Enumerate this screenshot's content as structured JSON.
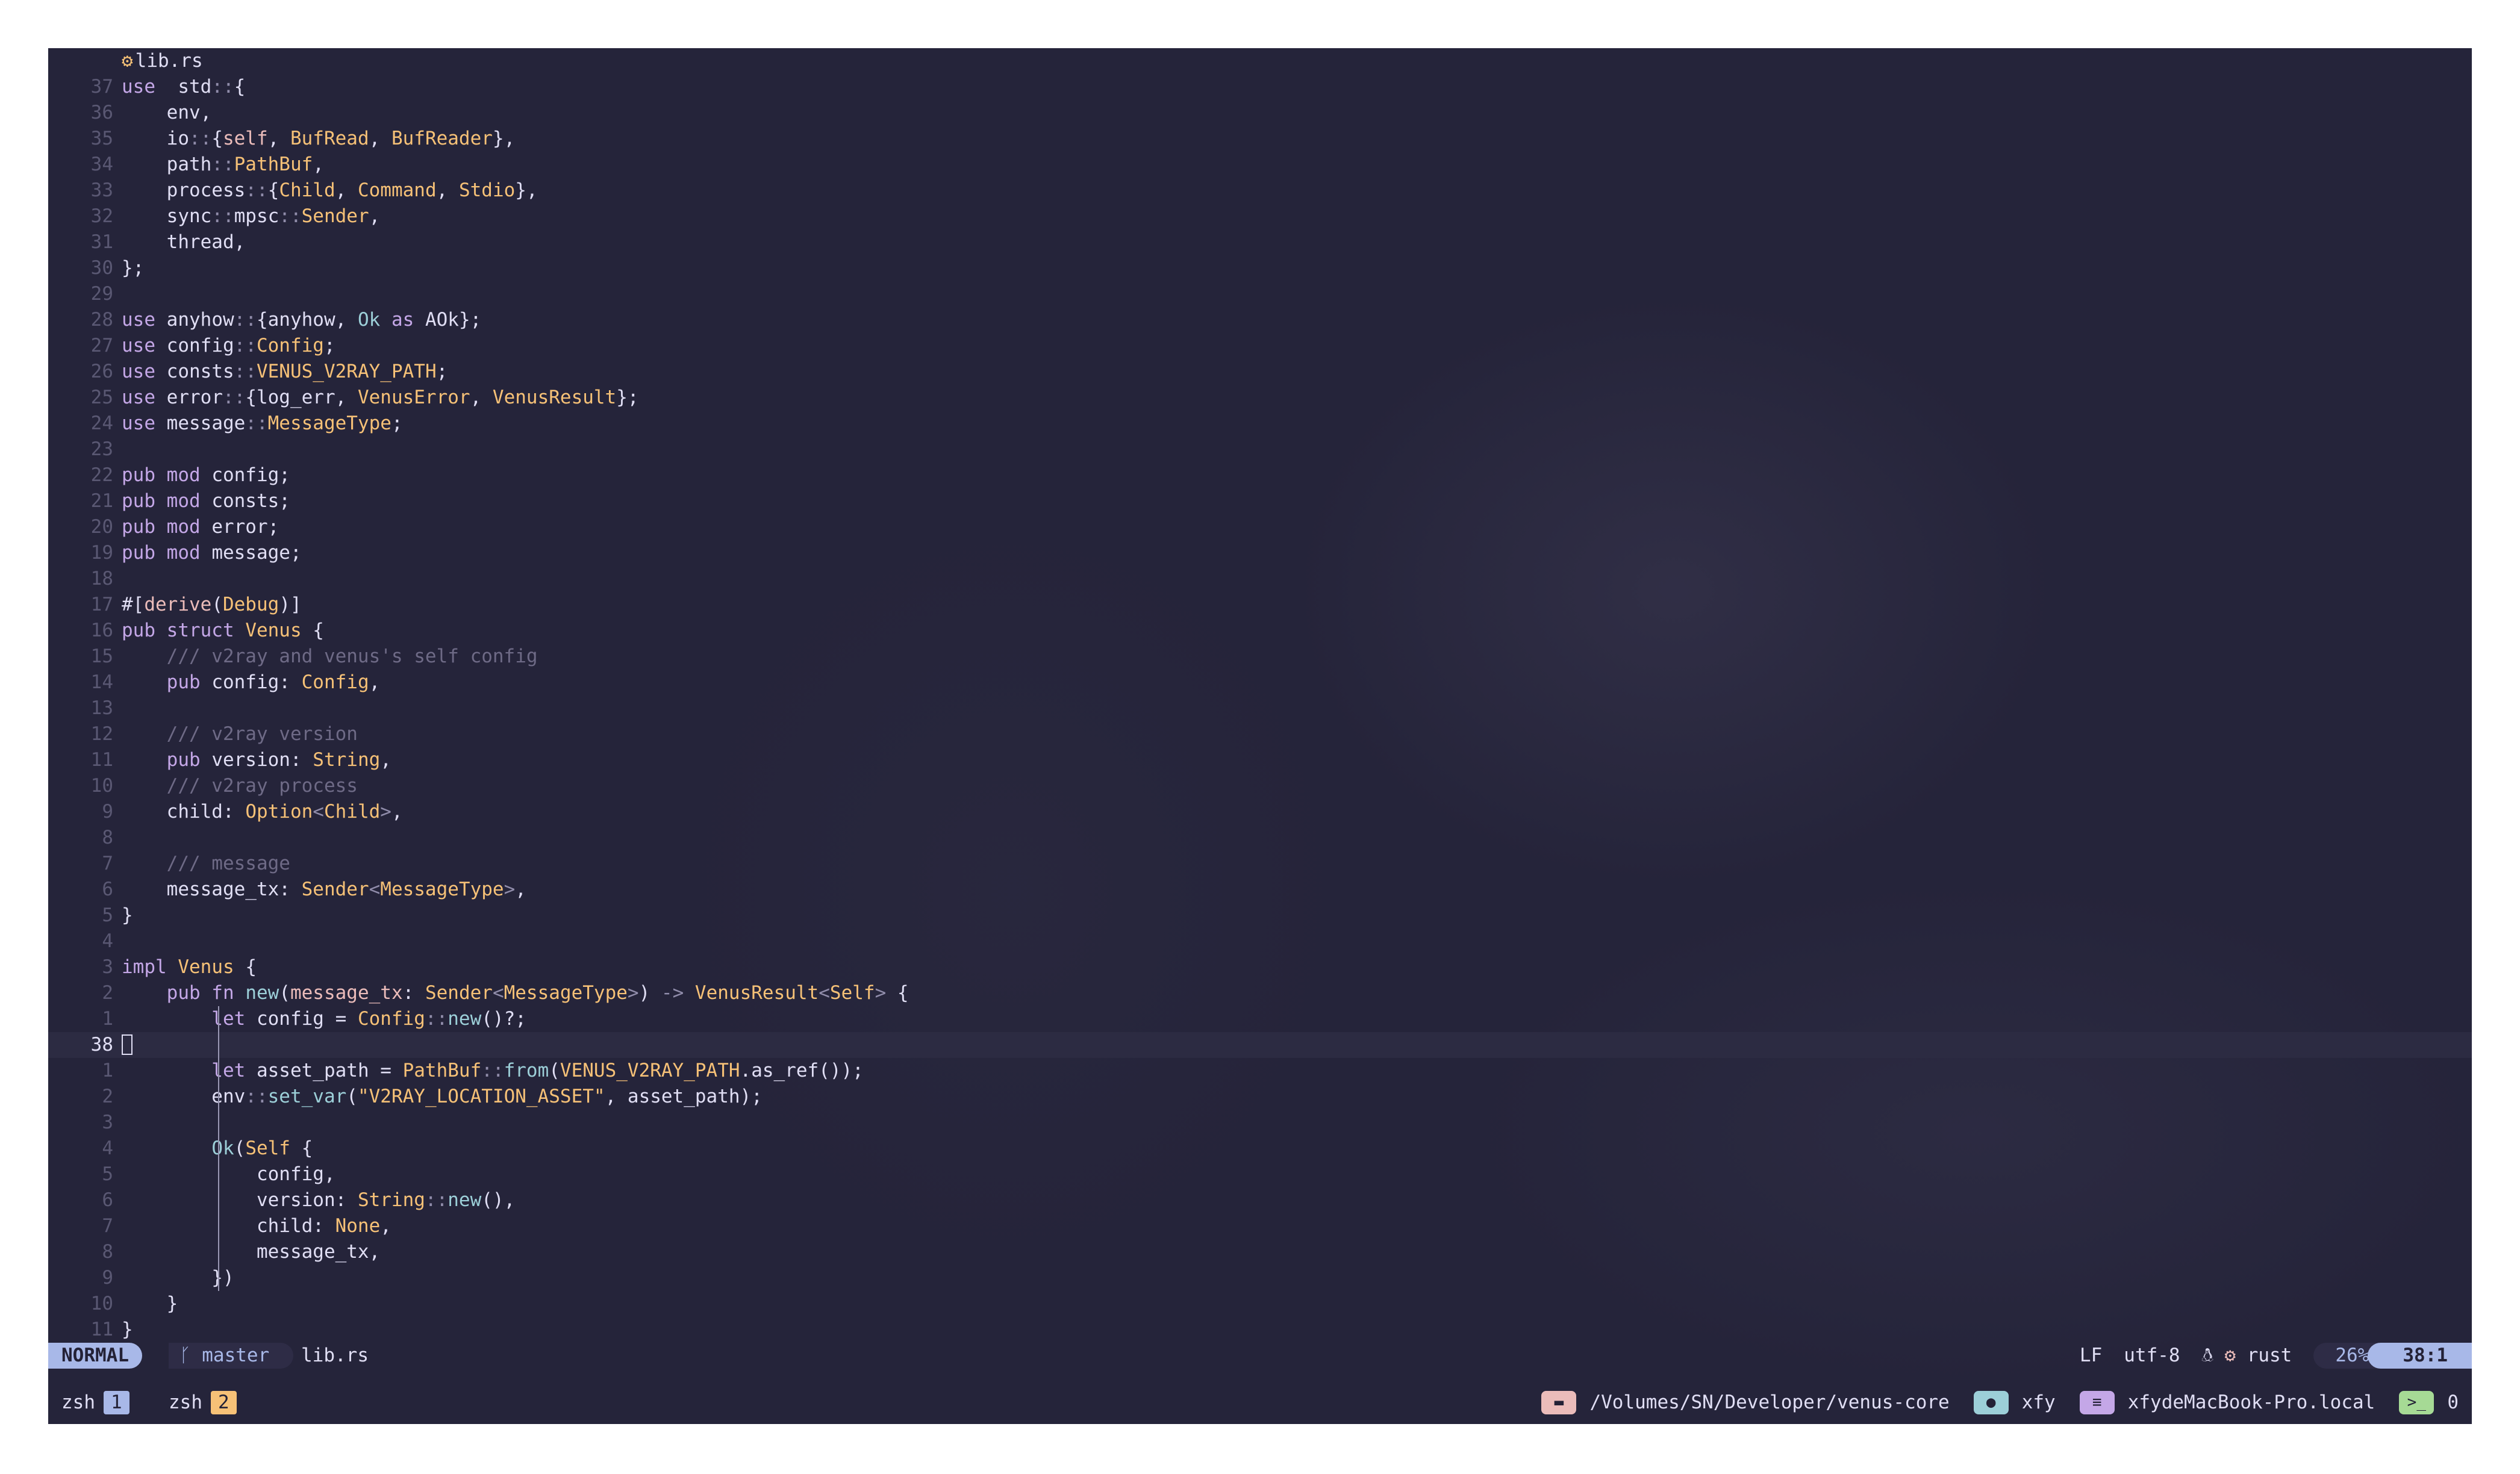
{
  "editor": {
    "file_tab": "lib.rs",
    "rows": [
      {
        "ln": "37",
        "code": [
          [
            "kw",
            "use"
          ],
          [
            "",
            "  std"
          ],
          [
            "pu",
            "::"
          ],
          [
            "",
            "{"
          ]
        ]
      },
      {
        "ln": "36",
        "code": [
          [
            "",
            "    env,"
          ]
        ]
      },
      {
        "ln": "35",
        "code": [
          [
            "",
            "    io"
          ],
          [
            "pu",
            "::"
          ],
          [
            "",
            "{"
          ],
          [
            "ma",
            "self"
          ],
          [
            "",
            ", "
          ],
          [
            "ty",
            "BufRead"
          ],
          [
            "",
            ", "
          ],
          [
            "ty",
            "BufReader"
          ],
          [
            "",
            "},"
          ]
        ]
      },
      {
        "ln": "34",
        "code": [
          [
            "",
            "    path"
          ],
          [
            "pu",
            "::"
          ],
          [
            "ty",
            "PathBuf"
          ],
          [
            "",
            ","
          ]
        ]
      },
      {
        "ln": "33",
        "code": [
          [
            "",
            "    process"
          ],
          [
            "pu",
            "::"
          ],
          [
            "",
            "{"
          ],
          [
            "ty",
            "Child"
          ],
          [
            "",
            ", "
          ],
          [
            "ty",
            "Command"
          ],
          [
            "",
            ", "
          ],
          [
            "ty",
            "Stdio"
          ],
          [
            "",
            "},"
          ]
        ]
      },
      {
        "ln": "32",
        "code": [
          [
            "",
            "    sync"
          ],
          [
            "pu",
            "::"
          ],
          [
            "",
            "mpsc"
          ],
          [
            "pu",
            "::"
          ],
          [
            "ty",
            "Sender"
          ],
          [
            "",
            ","
          ]
        ]
      },
      {
        "ln": "31",
        "code": [
          [
            "",
            "    thread,"
          ]
        ]
      },
      {
        "ln": "30",
        "code": [
          [
            "",
            "};"
          ]
        ]
      },
      {
        "ln": "29",
        "code": []
      },
      {
        "ln": "28",
        "code": [
          [
            "kw",
            "use"
          ],
          [
            "",
            " anyhow"
          ],
          [
            "pu",
            "::"
          ],
          [
            "",
            "{anyhow, "
          ],
          [
            "fn",
            "Ok"
          ],
          [
            "kw",
            " as"
          ],
          [
            "",
            " AOk};"
          ]
        ]
      },
      {
        "ln": "27",
        "code": [
          [
            "kw",
            "use"
          ],
          [
            "",
            " config"
          ],
          [
            "pu",
            "::"
          ],
          [
            "ty",
            "Config"
          ],
          [
            "",
            ";"
          ]
        ]
      },
      {
        "ln": "26",
        "code": [
          [
            "kw",
            "use"
          ],
          [
            "",
            " consts"
          ],
          [
            "pu",
            "::"
          ],
          [
            "st",
            "VENUS_V2RAY_PATH"
          ],
          [
            "",
            ";"
          ]
        ]
      },
      {
        "ln": "25",
        "code": [
          [
            "kw",
            "use"
          ],
          [
            "",
            " error"
          ],
          [
            "pu",
            "::"
          ],
          [
            "",
            "{log_err, "
          ],
          [
            "ty",
            "VenusError"
          ],
          [
            "",
            ", "
          ],
          [
            "ty",
            "VenusResult"
          ],
          [
            "",
            "};"
          ]
        ]
      },
      {
        "ln": "24",
        "code": [
          [
            "kw",
            "use"
          ],
          [
            "",
            " message"
          ],
          [
            "pu",
            "::"
          ],
          [
            "ty",
            "MessageType"
          ],
          [
            "",
            ";"
          ]
        ]
      },
      {
        "ln": "23",
        "code": []
      },
      {
        "ln": "22",
        "code": [
          [
            "kw",
            "pub mod"
          ],
          [
            "",
            " config;"
          ]
        ]
      },
      {
        "ln": "21",
        "code": [
          [
            "kw",
            "pub mod"
          ],
          [
            "",
            " consts;"
          ]
        ]
      },
      {
        "ln": "20",
        "code": [
          [
            "kw",
            "pub mod"
          ],
          [
            "",
            " error;"
          ]
        ]
      },
      {
        "ln": "19",
        "code": [
          [
            "kw",
            "pub mod"
          ],
          [
            "",
            " message;"
          ]
        ]
      },
      {
        "ln": "18",
        "code": []
      },
      {
        "ln": "17",
        "code": [
          [
            "",
            "#["
          ],
          [
            "ma",
            "derive"
          ],
          [
            "",
            "("
          ],
          [
            "ty",
            "Debug"
          ],
          [
            "",
            ")]"
          ]
        ]
      },
      {
        "ln": "16",
        "code": [
          [
            "kw",
            "pub struct"
          ],
          [
            "",
            " "
          ],
          [
            "ty",
            "Venus"
          ],
          [
            "",
            " {"
          ]
        ]
      },
      {
        "ln": "15",
        "code": [
          [
            "cm",
            "    /// v2ray and venus's self config"
          ]
        ]
      },
      {
        "ln": "14",
        "code": [
          [
            "kw",
            "    pub"
          ],
          [
            "",
            " config: "
          ],
          [
            "ty",
            "Config"
          ],
          [
            "",
            ","
          ]
        ]
      },
      {
        "ln": "13",
        "code": []
      },
      {
        "ln": "12",
        "code": [
          [
            "cm",
            "    /// v2ray version"
          ]
        ]
      },
      {
        "ln": "11",
        "code": [
          [
            "kw",
            "    pub"
          ],
          [
            "",
            " version: "
          ],
          [
            "ty",
            "String"
          ],
          [
            "",
            ","
          ]
        ]
      },
      {
        "ln": "10",
        "code": [
          [
            "cm",
            "    /// v2ray process"
          ]
        ]
      },
      {
        "ln": "9",
        "code": [
          [
            "",
            "    child: "
          ],
          [
            "ty",
            "Option"
          ],
          [
            "pu",
            "<"
          ],
          [
            "ty",
            "Child"
          ],
          [
            "pu",
            ">"
          ],
          [
            "",
            ","
          ]
        ]
      },
      {
        "ln": "8",
        "code": []
      },
      {
        "ln": "7",
        "code": [
          [
            "cm",
            "    /// message"
          ]
        ]
      },
      {
        "ln": "6",
        "code": [
          [
            "",
            "    message_tx: "
          ],
          [
            "ty",
            "Sender"
          ],
          [
            "pu",
            "<"
          ],
          [
            "ty",
            "MessageType"
          ],
          [
            "pu",
            ">"
          ],
          [
            "",
            ","
          ]
        ]
      },
      {
        "ln": "5",
        "code": [
          [
            "",
            "}"
          ]
        ]
      },
      {
        "ln": "4",
        "code": []
      },
      {
        "ln": "3",
        "code": [
          [
            "kw",
            "impl"
          ],
          [
            "",
            " "
          ],
          [
            "ty",
            "Venus"
          ],
          [
            "",
            " {"
          ]
        ]
      },
      {
        "ln": "2",
        "code": [
          [
            "kw",
            "    pub fn"
          ],
          [
            "",
            " "
          ],
          [
            "fn",
            "new"
          ],
          [
            "",
            "("
          ],
          [
            "ma",
            "message_tx"
          ],
          [
            "",
            ": "
          ],
          [
            "ty",
            "Sender"
          ],
          [
            "pu",
            "<"
          ],
          [
            "ty",
            "MessageType"
          ],
          [
            "pu",
            ">"
          ],
          [
            "",
            ") "
          ],
          [
            "pu",
            "->"
          ],
          [
            "",
            " "
          ],
          [
            "ty",
            "VenusResult"
          ],
          [
            "pu",
            "<"
          ],
          [
            "ty",
            "Self"
          ],
          [
            "pu",
            ">"
          ],
          [
            "",
            " {"
          ]
        ]
      },
      {
        "ln": "1",
        "code": [
          [
            "kw",
            "        let"
          ],
          [
            "",
            " config = "
          ],
          [
            "ty",
            "Config"
          ],
          [
            "pu",
            "::"
          ],
          [
            "fn",
            "new"
          ],
          [
            "",
            "()?;"
          ]
        ]
      },
      {
        "ln": "38",
        "cur": true,
        "code": []
      },
      {
        "ln": "1",
        "code": [
          [
            "kw",
            "        let"
          ],
          [
            "",
            " asset_path = "
          ],
          [
            "ty",
            "PathBuf"
          ],
          [
            "pu",
            "::"
          ],
          [
            "fn",
            "from"
          ],
          [
            "",
            "("
          ],
          [
            "st",
            "VENUS_V2RAY_PATH"
          ],
          [
            "",
            ".as_ref());"
          ]
        ]
      },
      {
        "ln": "2",
        "code": [
          [
            "",
            "        env"
          ],
          [
            "pu",
            "::"
          ],
          [
            "fn",
            "set_var"
          ],
          [
            "",
            "("
          ],
          [
            "st",
            "\"V2RAY_LOCATION_ASSET\""
          ],
          [
            "",
            ", asset_path);"
          ]
        ]
      },
      {
        "ln": "3",
        "code": []
      },
      {
        "ln": "4",
        "code": [
          [
            "",
            "        "
          ],
          [
            "fn",
            "Ok"
          ],
          [
            "",
            "("
          ],
          [
            "ty",
            "Self"
          ],
          [
            "",
            " {"
          ]
        ]
      },
      {
        "ln": "5",
        "code": [
          [
            "",
            "            config,"
          ]
        ]
      },
      {
        "ln": "6",
        "code": [
          [
            "",
            "            version: "
          ],
          [
            "ty",
            "String"
          ],
          [
            "pu",
            "::"
          ],
          [
            "fn",
            "new"
          ],
          [
            "",
            "(),"
          ]
        ]
      },
      {
        "ln": "7",
        "code": [
          [
            "",
            "            child: "
          ],
          [
            "st",
            "None"
          ],
          [
            "",
            ","
          ]
        ]
      },
      {
        "ln": "8",
        "code": [
          [
            "",
            "            message_tx,"
          ]
        ]
      },
      {
        "ln": "9",
        "code": [
          [
            "",
            "        })"
          ]
        ]
      },
      {
        "ln": "10",
        "code": [
          [
            "",
            "    }"
          ]
        ]
      },
      {
        "ln": "11",
        "code": [
          [
            "",
            "}"
          ]
        ]
      }
    ]
  },
  "statusline": {
    "mode": "NORMAL",
    "branch": "master",
    "file": "lib.rs",
    "eol": "LF",
    "encoding": "utf-8",
    "filetype": "rust",
    "percent": "26%",
    "position": "38:1"
  },
  "tmux": {
    "windows": [
      {
        "name": "zsh",
        "num": "1",
        "color": "#a8b8e8"
      },
      {
        "name": "zsh",
        "num": "2",
        "color": "#f6c177"
      }
    ],
    "path": "/Volumes/SN/Developer/venus-core",
    "user": "xfy",
    "host": "xfydeMacBook-Pro.local",
    "panes": "0"
  },
  "icons": {
    "branch": "git-branch-icon",
    "os": "linux-tux-icon",
    "rust": "rust-gear-icon",
    "folder": "folder-icon",
    "user": "user-icon",
    "host": "server-icon",
    "terminal": "terminal-icon"
  },
  "colors": {
    "background": "#25243a",
    "foreground": "#e0def4",
    "keyword": "#c4a7e7",
    "type": "#f6c177",
    "function": "#9ccfd8",
    "comment": "#6e6a86",
    "accent": "#a8b8e8"
  }
}
